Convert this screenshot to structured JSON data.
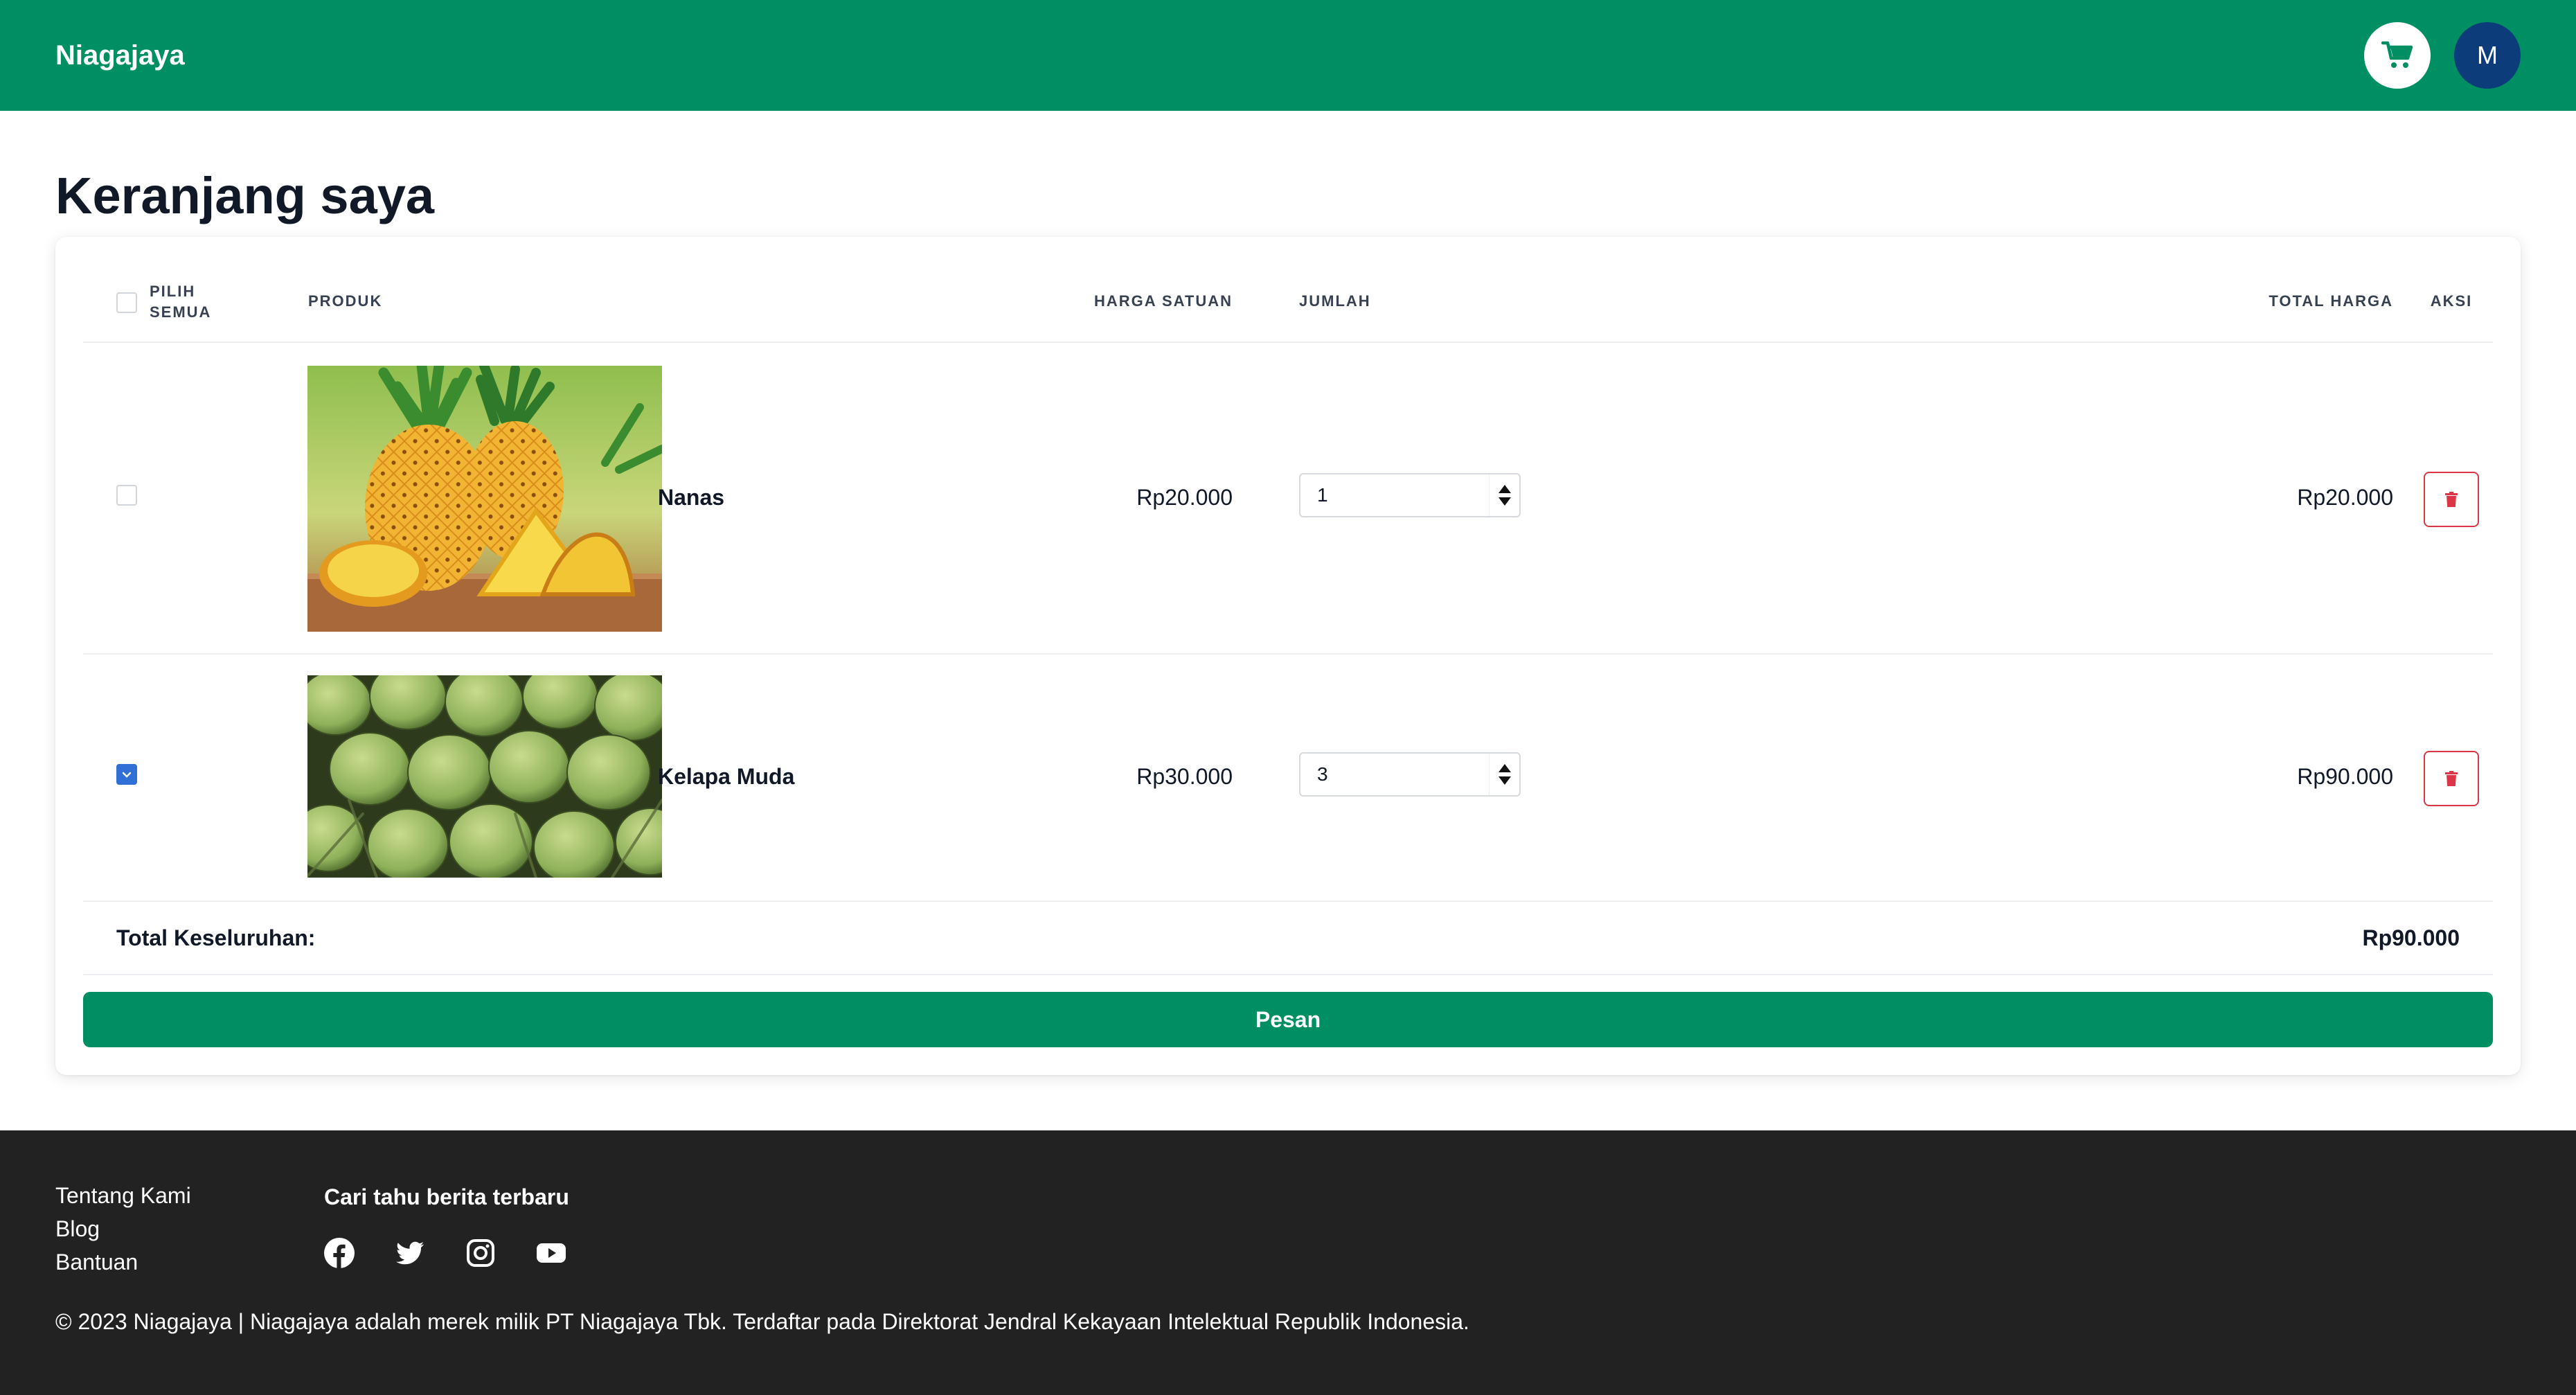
{
  "header": {
    "brand": "Niagajaya",
    "avatar_initial": "M",
    "colors": {
      "brand": "#008f62",
      "avatar": "#0c3d7a"
    }
  },
  "page": {
    "title": "Keranjang saya"
  },
  "table": {
    "headers": {
      "select_all": "PILIH SEMUA",
      "product": "PRODUK",
      "unit_price": "HARGA SATUAN",
      "quantity": "JUMLAH",
      "total_price": "TOTAL HARGA",
      "action": "AKSI"
    },
    "select_all_checked": false,
    "rows": [
      {
        "checked": false,
        "name": "Nanas",
        "unit_price": "Rp20.000",
        "quantity": "1",
        "total_price": "Rp20.000",
        "image": "pineapple-photo"
      },
      {
        "checked": true,
        "name": "Kelapa Muda",
        "unit_price": "Rp30.000",
        "quantity": "3",
        "total_price": "Rp90.000",
        "image": "young-coconut-photo"
      }
    ]
  },
  "summary": {
    "label": "Total Keseluruhan:",
    "value": "Rp90.000"
  },
  "order_button": "Pesan",
  "footer": {
    "links": [
      "Tentang Kami",
      "Blog",
      "Bantuan"
    ],
    "news_title": "Cari tahu berita terbaru",
    "socials": [
      "facebook-icon",
      "twitter-icon",
      "instagram-icon",
      "youtube-icon"
    ],
    "copyright": "© 2023 Niagajaya | Niagajaya adalah merek milik PT Niagajaya Tbk. Terdaftar pada Direktorat Jendral Kekayaan Intelektual Republik Indonesia."
  }
}
